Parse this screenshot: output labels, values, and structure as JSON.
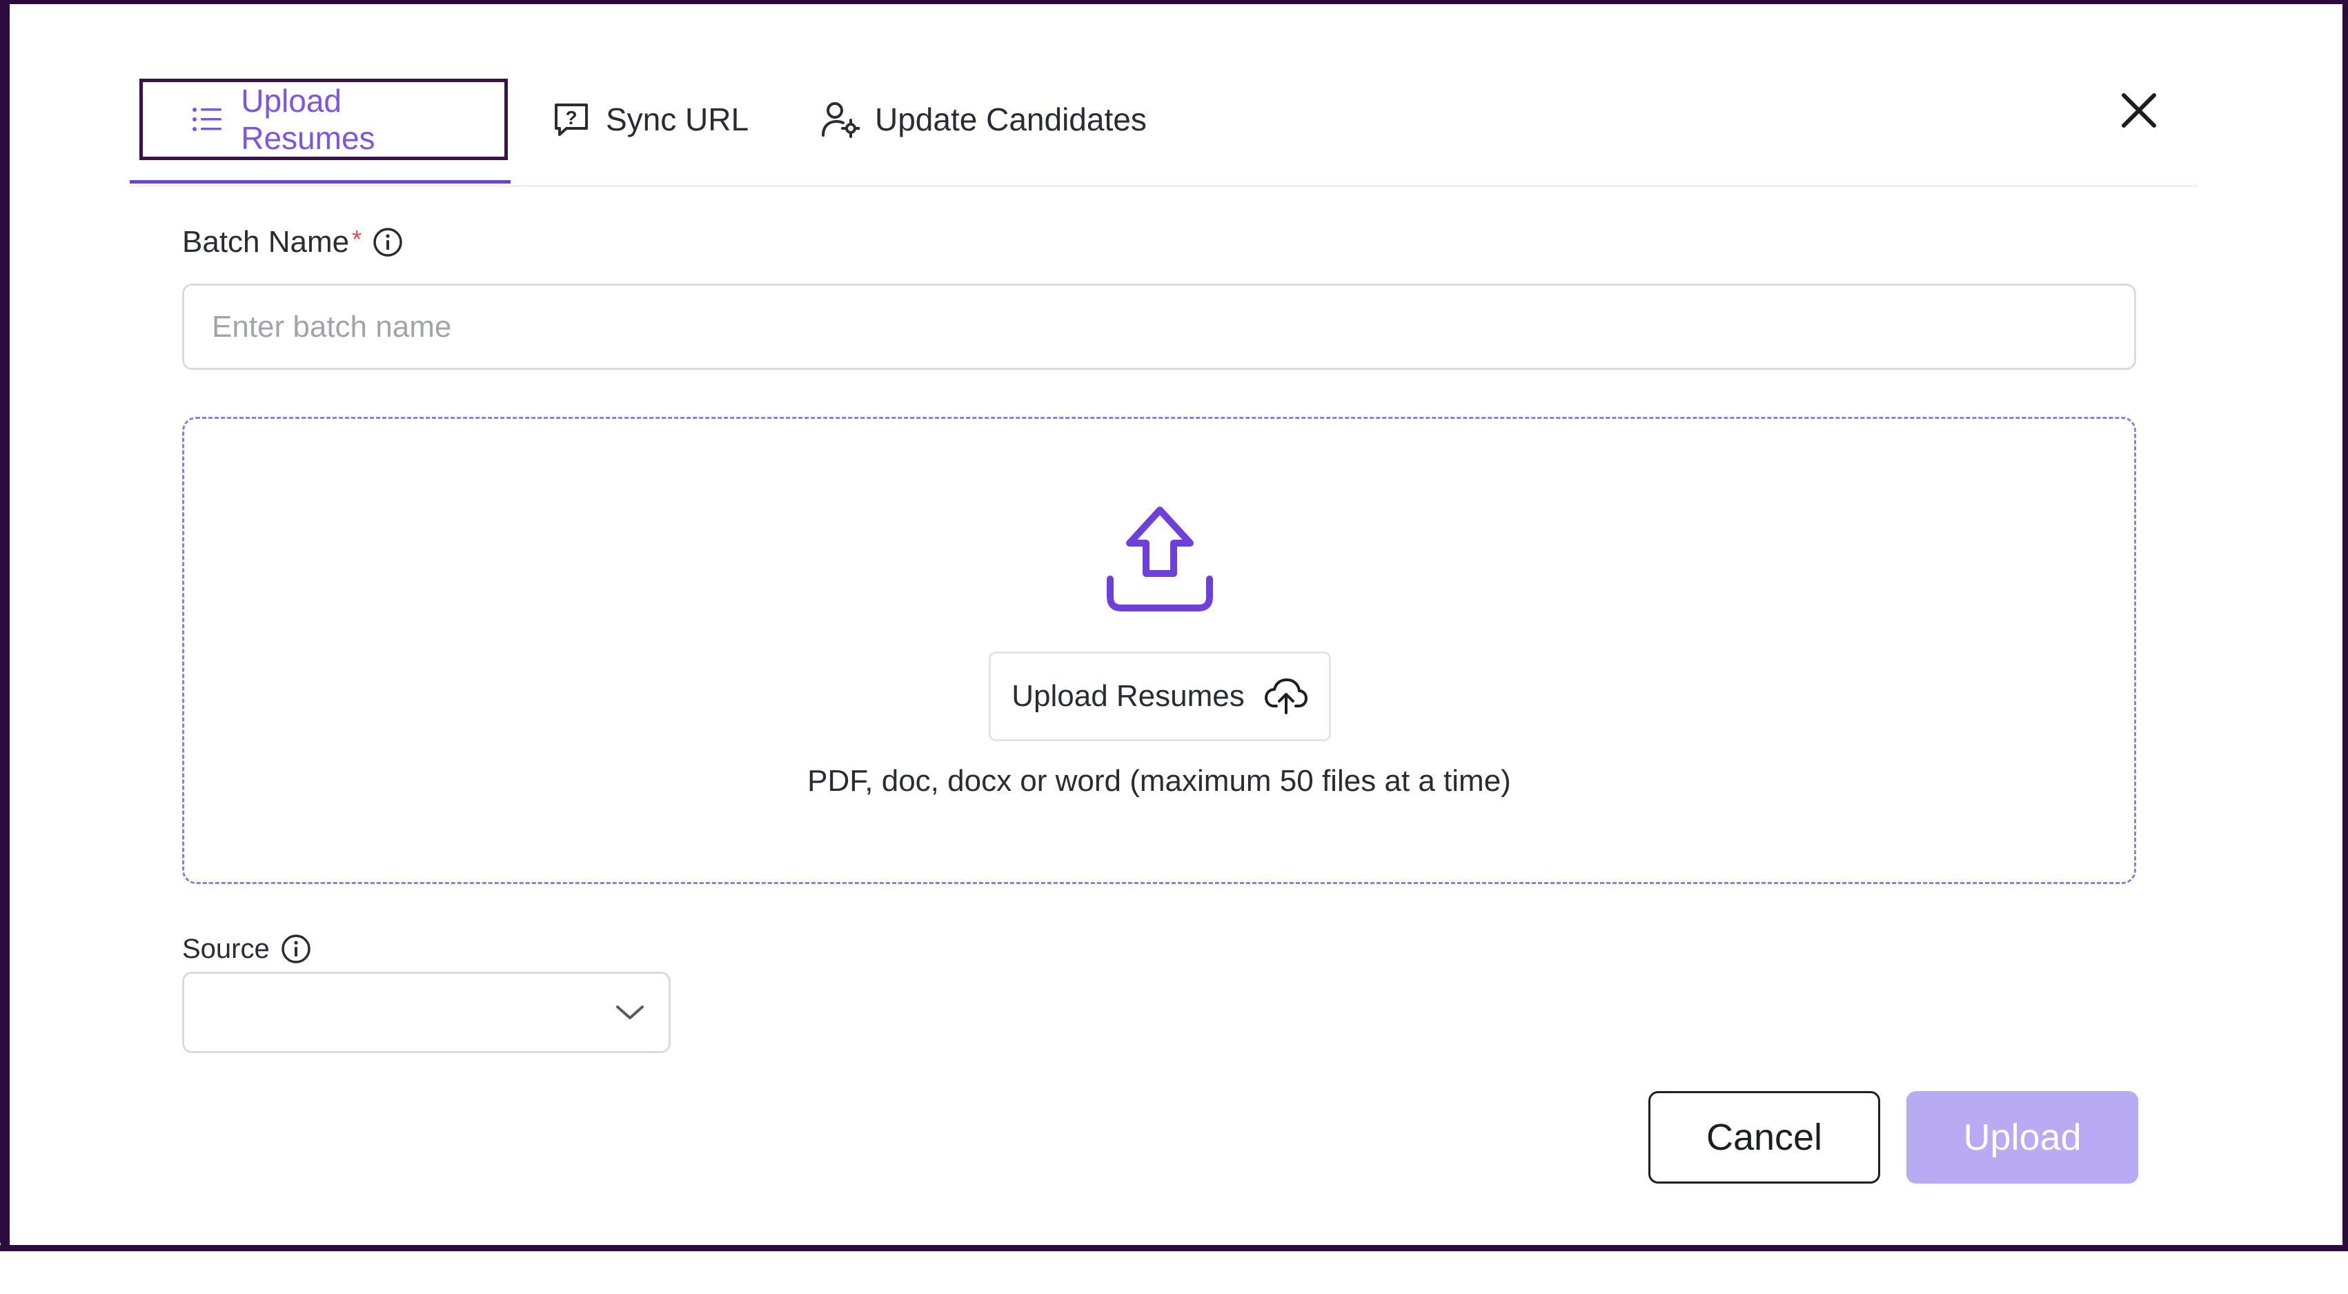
{
  "tabs": [
    {
      "label": "Upload Resumes",
      "icon": "list-icon",
      "active": true
    },
    {
      "label": "Sync URL",
      "icon": "question-box-icon",
      "active": false
    },
    {
      "label": "Update Candidates",
      "icon": "user-gear-icon",
      "active": false
    }
  ],
  "batch": {
    "label": "Batch Name",
    "required_mark": "*",
    "placeholder": "Enter batch name",
    "value": ""
  },
  "dropzone": {
    "button_label": "Upload Resumes",
    "hint": "PDF, doc, docx or word (maximum 50 files at a time)"
  },
  "source": {
    "label": "Source",
    "value": ""
  },
  "footer": {
    "cancel_label": "Cancel",
    "upload_label": "Upload"
  },
  "colors": {
    "accent": "#7b55e8",
    "upload_disabled": "#b8aaf3",
    "frame": "#2b0b3d",
    "required": "#e5484d"
  }
}
